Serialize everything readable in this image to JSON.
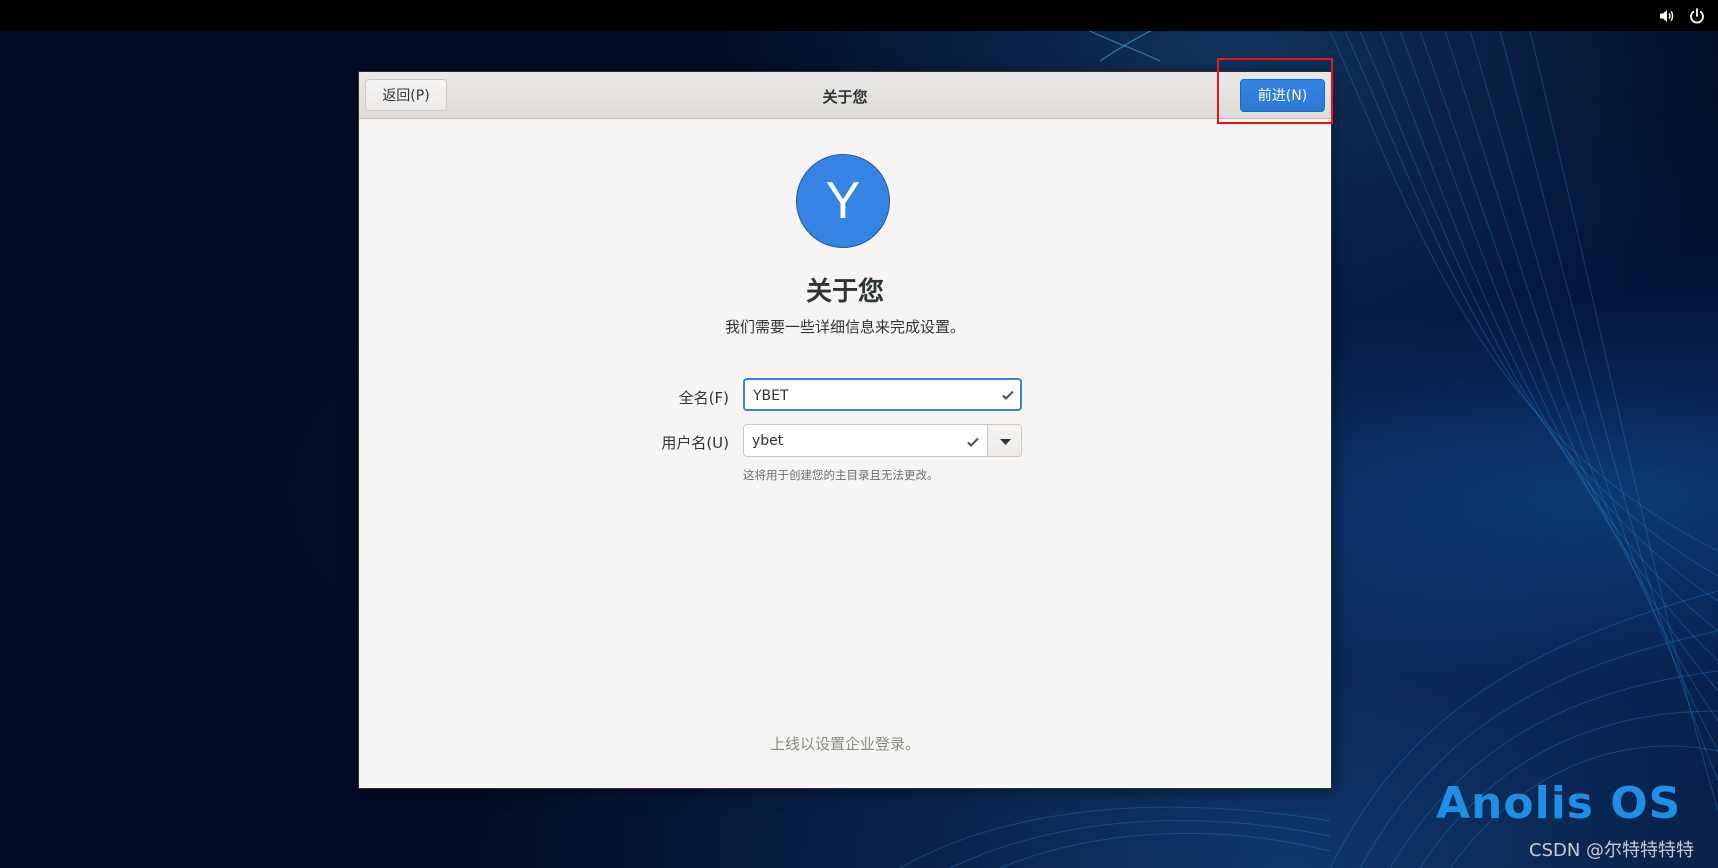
{
  "topbar": {
    "icons": [
      "volume-icon",
      "power-icon"
    ]
  },
  "window": {
    "title": "关于您",
    "back_label": "返回(P)",
    "next_label": "前进(N)"
  },
  "avatar": {
    "letter": "Y",
    "color": "#3584e4"
  },
  "page": {
    "heading": "关于您",
    "subtitle": "我们需要一些详细信息来完成设置。"
  },
  "form": {
    "fullname_label": "全名(F)",
    "fullname_value": "YBET",
    "username_label": "用户名(U)",
    "username_value": "ybet",
    "username_hint": "这将用于创建您的主目录且无法更改。"
  },
  "footer": {
    "enterprise_login": "上线以设置企业登录。"
  },
  "desktop": {
    "brand": "Anolis OS",
    "watermark": "CSDN @尔特特特特"
  },
  "colors": {
    "accent": "#3584e4",
    "highlight": "#e8151b"
  }
}
